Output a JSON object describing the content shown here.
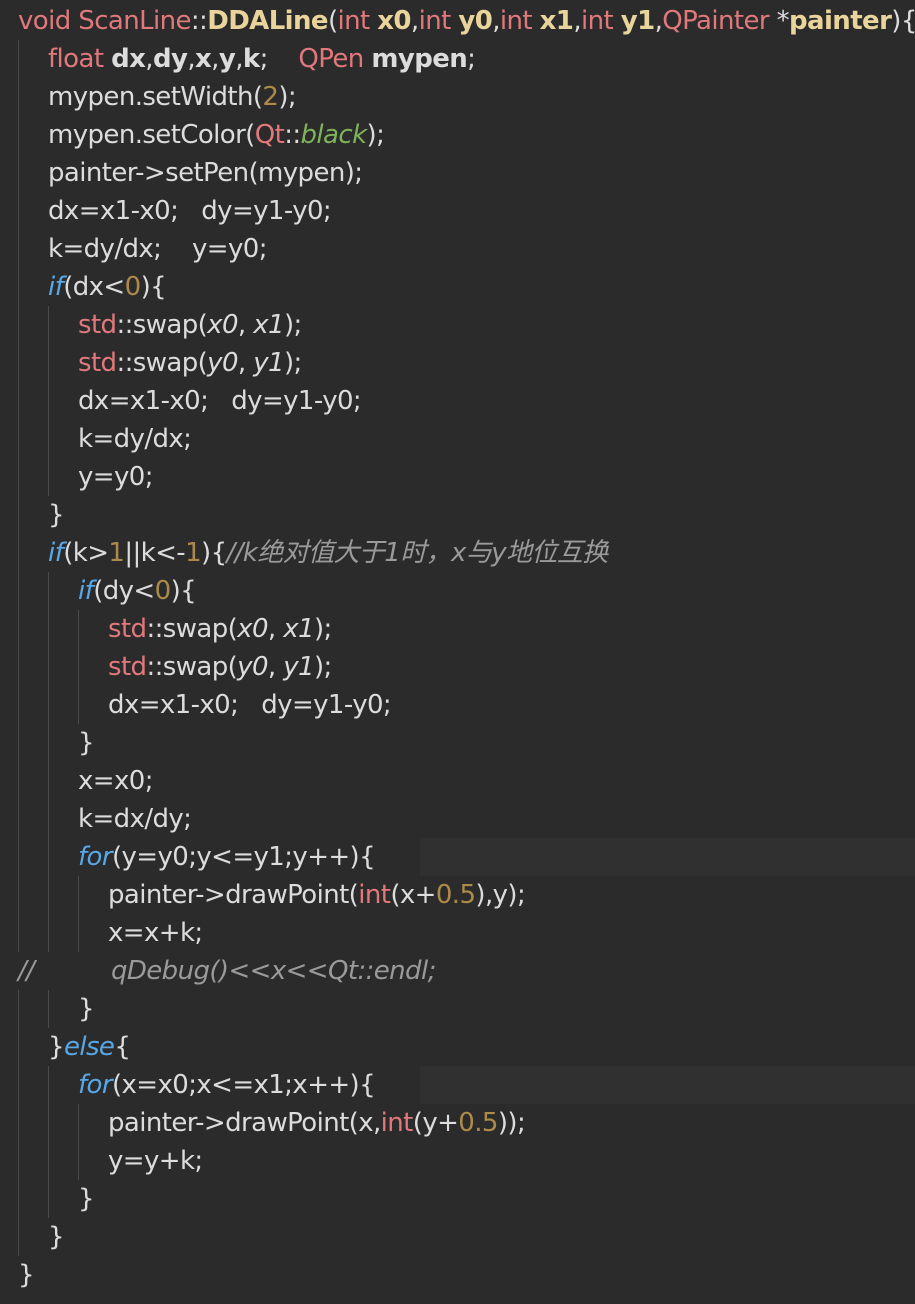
{
  "editor": {
    "theme": {
      "background": "#2b2b2b",
      "default_text": "#dcdcdc",
      "keyword": "#e0787c",
      "function_name": "#e9d59b",
      "control_keyword": "#58a7e6",
      "number": "#ae8a4a",
      "enum_value": "#7db35a",
      "comment": "#9a9a9a"
    },
    "lines": [
      {
        "indent": 0,
        "hl": false,
        "tokens": [
          {
            "t": "void ",
            "c": "keyword"
          },
          {
            "t": "ScanLine",
            "c": "type"
          },
          {
            "t": "::",
            "c": "default"
          },
          {
            "t": "DDALine",
            "c": "func"
          },
          {
            "t": "(",
            "c": "default"
          },
          {
            "t": "int ",
            "c": "keyword"
          },
          {
            "t": "x0",
            "c": "param"
          },
          {
            "t": ",",
            "c": "default"
          },
          {
            "t": "int ",
            "c": "keyword"
          },
          {
            "t": "y0",
            "c": "param"
          },
          {
            "t": ",",
            "c": "default"
          },
          {
            "t": "int ",
            "c": "keyword"
          },
          {
            "t": "x1",
            "c": "param"
          },
          {
            "t": ",",
            "c": "default"
          },
          {
            "t": "int ",
            "c": "keyword"
          },
          {
            "t": "y1",
            "c": "param"
          },
          {
            "t": ",",
            "c": "default"
          },
          {
            "t": "QPainter ",
            "c": "type"
          },
          {
            "t": "*",
            "c": "default"
          },
          {
            "t": "painter",
            "c": "param"
          },
          {
            "t": "){",
            "c": "default"
          }
        ]
      },
      {
        "indent": 1,
        "hl": false,
        "tokens": [
          {
            "t": "float ",
            "c": "keyword"
          },
          {
            "t": "dx",
            "c": "bold"
          },
          {
            "t": ",",
            "c": "default"
          },
          {
            "t": "dy",
            "c": "bold"
          },
          {
            "t": ",",
            "c": "default"
          },
          {
            "t": "x",
            "c": "bold"
          },
          {
            "t": ",",
            "c": "default"
          },
          {
            "t": "y",
            "c": "bold"
          },
          {
            "t": ",",
            "c": "default"
          },
          {
            "t": "k",
            "c": "bold"
          },
          {
            "t": ";    ",
            "c": "default"
          },
          {
            "t": "QPen ",
            "c": "type"
          },
          {
            "t": "mypen",
            "c": "bold"
          },
          {
            "t": ";",
            "c": "default"
          }
        ]
      },
      {
        "indent": 1,
        "hl": false,
        "tokens": [
          {
            "t": "mypen.setWidth(",
            "c": "default"
          },
          {
            "t": "2",
            "c": "num"
          },
          {
            "t": ");",
            "c": "default"
          }
        ]
      },
      {
        "indent": 1,
        "hl": false,
        "tokens": [
          {
            "t": "mypen.setColor(",
            "c": "default"
          },
          {
            "t": "Qt",
            "c": "ns"
          },
          {
            "t": "::",
            "c": "default"
          },
          {
            "t": "black",
            "c": "enum"
          },
          {
            "t": ");",
            "c": "default"
          }
        ]
      },
      {
        "indent": 1,
        "hl": false,
        "tokens": [
          {
            "t": "painter->setPen(mypen);",
            "c": "default"
          }
        ]
      },
      {
        "indent": 1,
        "hl": false,
        "tokens": [
          {
            "t": "dx=x1-x0;   dy=y1-y0;",
            "c": "default"
          }
        ]
      },
      {
        "indent": 1,
        "hl": false,
        "tokens": [
          {
            "t": "k=dy/dx;    y=y0;",
            "c": "default"
          }
        ]
      },
      {
        "indent": 1,
        "hl": false,
        "tokens": [
          {
            "t": "if",
            "c": "ctrl"
          },
          {
            "t": "(dx<",
            "c": "default"
          },
          {
            "t": "0",
            "c": "num"
          },
          {
            "t": "){",
            "c": "default"
          }
        ]
      },
      {
        "indent": 2,
        "hl": false,
        "tokens": [
          {
            "t": "std",
            "c": "ns"
          },
          {
            "t": "::swap(",
            "c": "default"
          },
          {
            "t": "x0",
            "c": "italic"
          },
          {
            "t": ", ",
            "c": "default"
          },
          {
            "t": "x1",
            "c": "italic"
          },
          {
            "t": ");",
            "c": "default"
          }
        ]
      },
      {
        "indent": 2,
        "hl": false,
        "tokens": [
          {
            "t": "std",
            "c": "ns"
          },
          {
            "t": "::swap(",
            "c": "default"
          },
          {
            "t": "y0",
            "c": "italic"
          },
          {
            "t": ", ",
            "c": "default"
          },
          {
            "t": "y1",
            "c": "italic"
          },
          {
            "t": ");",
            "c": "default"
          }
        ]
      },
      {
        "indent": 2,
        "hl": false,
        "tokens": [
          {
            "t": "dx=x1-x0;   dy=y1-y0;",
            "c": "default"
          }
        ]
      },
      {
        "indent": 2,
        "hl": false,
        "tokens": [
          {
            "t": "k=dy/dx;",
            "c": "default"
          }
        ]
      },
      {
        "indent": 2,
        "hl": false,
        "tokens": [
          {
            "t": "y=y0;",
            "c": "default"
          }
        ]
      },
      {
        "indent": 1,
        "hl": false,
        "tokens": [
          {
            "t": "}",
            "c": "default"
          }
        ]
      },
      {
        "indent": 1,
        "hl": false,
        "tokens": [
          {
            "t": "if",
            "c": "ctrl"
          },
          {
            "t": "(k>",
            "c": "default"
          },
          {
            "t": "1",
            "c": "num"
          },
          {
            "t": "||k<-",
            "c": "default"
          },
          {
            "t": "1",
            "c": "num"
          },
          {
            "t": "){",
            "c": "default"
          },
          {
            "t": "//k绝对值大于1时，x与y地位互换",
            "c": "comment"
          }
        ]
      },
      {
        "indent": 2,
        "hl": false,
        "tokens": [
          {
            "t": "if",
            "c": "ctrl"
          },
          {
            "t": "(dy<",
            "c": "default"
          },
          {
            "t": "0",
            "c": "num"
          },
          {
            "t": "){",
            "c": "default"
          }
        ]
      },
      {
        "indent": 3,
        "hl": false,
        "tokens": [
          {
            "t": "std",
            "c": "ns"
          },
          {
            "t": "::swap(",
            "c": "default"
          },
          {
            "t": "x0",
            "c": "italic"
          },
          {
            "t": ", ",
            "c": "default"
          },
          {
            "t": "x1",
            "c": "italic"
          },
          {
            "t": ");",
            "c": "default"
          }
        ]
      },
      {
        "indent": 3,
        "hl": false,
        "tokens": [
          {
            "t": "std",
            "c": "ns"
          },
          {
            "t": "::swap(",
            "c": "default"
          },
          {
            "t": "y0",
            "c": "italic"
          },
          {
            "t": ", ",
            "c": "default"
          },
          {
            "t": "y1",
            "c": "italic"
          },
          {
            "t": ");",
            "c": "default"
          }
        ]
      },
      {
        "indent": 3,
        "hl": false,
        "tokens": [
          {
            "t": "dx=x1-x0;   dy=y1-y0;",
            "c": "default"
          }
        ]
      },
      {
        "indent": 2,
        "hl": false,
        "tokens": [
          {
            "t": "}",
            "c": "default"
          }
        ]
      },
      {
        "indent": 2,
        "hl": false,
        "tokens": [
          {
            "t": "x=x0;",
            "c": "default"
          }
        ]
      },
      {
        "indent": 2,
        "hl": false,
        "tokens": [
          {
            "t": "k=dx/dy;",
            "c": "default"
          }
        ]
      },
      {
        "indent": 2,
        "hl": true,
        "tokens": [
          {
            "t": "for",
            "c": "ctrl"
          },
          {
            "t": "(y=y0;y<=y1;y++){",
            "c": "default"
          }
        ]
      },
      {
        "indent": 3,
        "hl": false,
        "tokens": [
          {
            "t": "painter->drawPoint(",
            "c": "default"
          },
          {
            "t": "int",
            "c": "keyword"
          },
          {
            "t": "(x+",
            "c": "default"
          },
          {
            "t": "0.5",
            "c": "num"
          },
          {
            "t": "),y);",
            "c": "default"
          }
        ]
      },
      {
        "indent": 3,
        "hl": false,
        "tokens": [
          {
            "t": "x=x+k;",
            "c": "default"
          }
        ]
      },
      {
        "indent": 0,
        "hl": false,
        "tokens": [
          {
            "t": "//          qDebug()<<x<<Qt::endl;",
            "c": "comment"
          }
        ]
      },
      {
        "indent": 2,
        "hl": false,
        "tokens": [
          {
            "t": "}",
            "c": "default"
          }
        ]
      },
      {
        "indent": 1,
        "hl": false,
        "tokens": [
          {
            "t": "}",
            "c": "default"
          },
          {
            "t": "else",
            "c": "ctrl"
          },
          {
            "t": "{",
            "c": "default"
          }
        ]
      },
      {
        "indent": 2,
        "hl": true,
        "tokens": [
          {
            "t": "for",
            "c": "ctrl"
          },
          {
            "t": "(x=x0;x<=x1;x++){",
            "c": "default"
          }
        ]
      },
      {
        "indent": 3,
        "hl": false,
        "tokens": [
          {
            "t": "painter->drawPoint(x,",
            "c": "default"
          },
          {
            "t": "int",
            "c": "keyword"
          },
          {
            "t": "(y+",
            "c": "default"
          },
          {
            "t": "0.5",
            "c": "num"
          },
          {
            "t": "));",
            "c": "default"
          }
        ]
      },
      {
        "indent": 3,
        "hl": false,
        "tokens": [
          {
            "t": "y=y+k;",
            "c": "default"
          }
        ]
      },
      {
        "indent": 2,
        "hl": false,
        "tokens": [
          {
            "t": "}",
            "c": "default"
          }
        ]
      },
      {
        "indent": 1,
        "hl": false,
        "tokens": [
          {
            "t": "}",
            "c": "default"
          }
        ]
      },
      {
        "indent": 0,
        "hl": false,
        "tokens": [
          {
            "t": "}",
            "c": "default"
          }
        ]
      }
    ]
  }
}
